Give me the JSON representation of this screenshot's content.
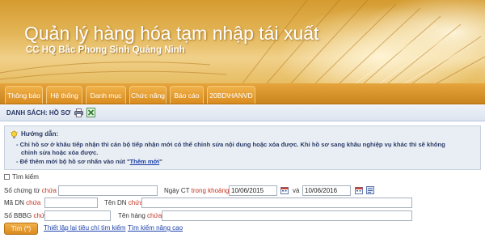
{
  "header": {
    "title": "Quản lý hàng hóa tạm nhập tái xuất",
    "subtitle": "CC HQ Bắc Phong Sinh Quảng Ninh"
  },
  "nav": {
    "items": [
      {
        "label": "Thông báo"
      },
      {
        "label": "Hệ thống"
      },
      {
        "label": "Danh mục"
      },
      {
        "label": "Chức năng"
      },
      {
        "label": "Báo cáo"
      },
      {
        "label": "20BD\\HANVD"
      }
    ]
  },
  "section": {
    "title": "DANH SÁCH: HỒ SƠ",
    "icons": [
      "printer-icon",
      "excel-icon"
    ]
  },
  "guide": {
    "heading": "Hướng dẫn:",
    "line1": "- Chỉ hồ sơ ở khâu tiếp nhận thì cán bộ tiếp nhận mới có thể chỉnh sửa nội dung hoặc xóa được. Khi hồ sơ sang khâu nghiệp vụ khác thì sẽ không",
    "line2": "chỉnh sửa hoặc xóa được.",
    "line3_prefix": "- Để thêm mới bộ hồ sơ nhấn vào nút \"",
    "line3_link": "Thêm mới",
    "line3_suffix": "\""
  },
  "search": {
    "toggle_label": "Tìm kiếm",
    "so_chung_tu_label": "Số chứng từ",
    "so_chung_tu_cond": "chứa",
    "so_chung_tu_value": "",
    "ngay_ct_label": "Ngày CT",
    "ngay_ct_cond": "trong khoảng",
    "date_from": "10/06/2015",
    "and_label": "và",
    "date_to": "10/06/2016",
    "ma_dn_label": "Mã DN",
    "ma_dn_cond": "chứa",
    "ma_dn_value": "",
    "ten_dn_label": "Tên DN",
    "ten_dn_cond": "chứa",
    "ten_dn_value": "",
    "so_bbbg_label": "Số BBBG",
    "so_bbbg_cond": "chứa",
    "so_bbbg_value": "",
    "ten_hang_label": "Tên hàng",
    "ten_hang_cond": "chứa",
    "ten_hang_value": "",
    "search_button": "Tìm (*)",
    "reset_link": "Thiết lập lại tiêu chí tìm kiếm",
    "advanced_link": "Tìm kiếm nâng cao"
  },
  "colors": {
    "accent": "#d98b1e",
    "link": "#1a3faa",
    "condition": "#c2331f",
    "heading": "#2a3a66"
  }
}
